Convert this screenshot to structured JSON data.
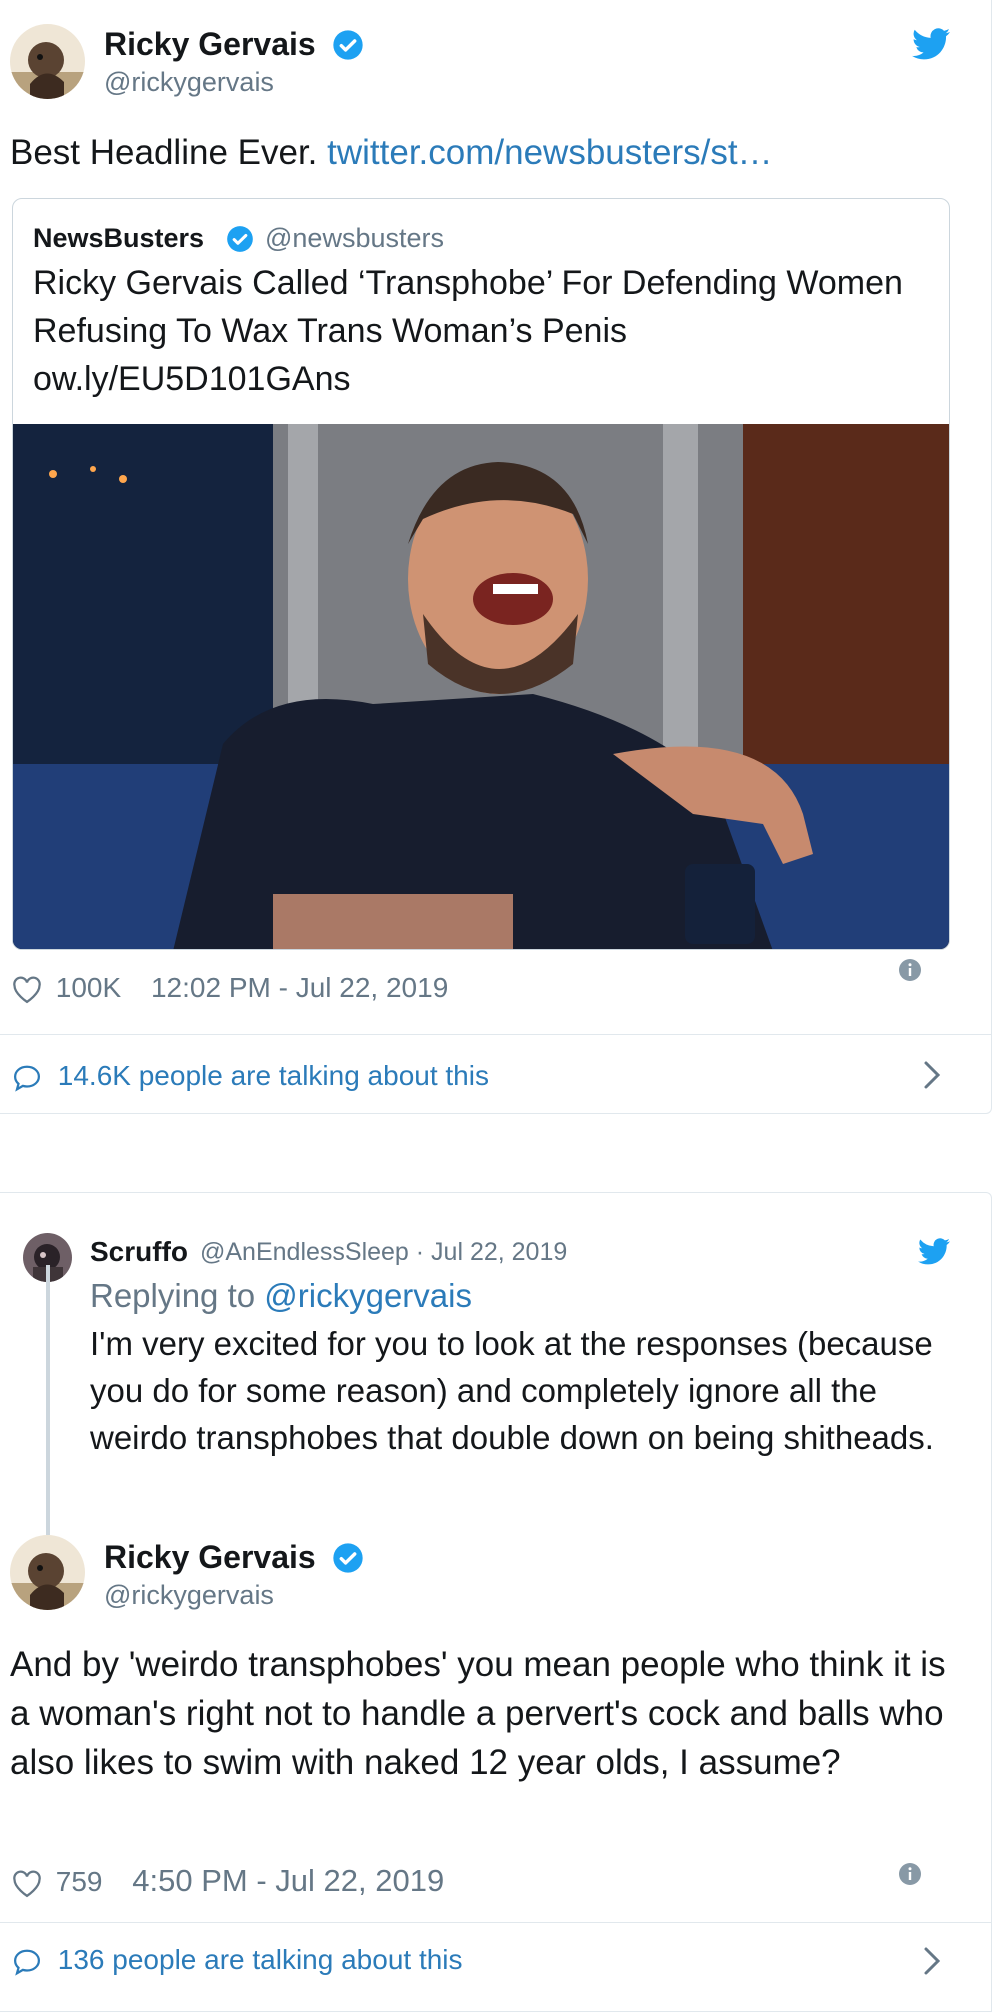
{
  "tweet1": {
    "author_name": "Ricky Gervais",
    "author_handle": "@rickygervais",
    "text": "Best Headline Ever.",
    "link_text": "twitter.com/newsbusters/st…",
    "quote": {
      "author_name": "NewsBusters",
      "author_handle": "@newsbusters",
      "text": "Ricky Gervais Called ‘Transphobe’ For Defending Women Refusing To Wax Trans Woman’s Penis",
      "link": "ow.ly/EU5D101GAns"
    },
    "likes": "100K",
    "timestamp": "12:02 PM - Jul 22, 2019",
    "talking": "14.6K people are talking about this"
  },
  "tweet2": {
    "reply": {
      "author_name": "Scruffo",
      "author_handle": "@AnEndlessSleep · Jul 22, 2019",
      "replying_label": "Replying to",
      "replying_handle": "@rickygervais",
      "text": "I'm very excited for you to look at the responses (because you do for some reason) and completely ignore all the weirdo transphobes that double down on being shitheads."
    },
    "author_name": "Ricky Gervais",
    "author_handle": "@rickygervais",
    "text": "And by 'weirdo transphobes' you mean people who think it is a woman's right not to handle a pervert's cock and balls who also likes to swim with naked 12 year olds, I assume?",
    "likes": "759",
    "timestamp": "4:50 PM - Jul 22, 2019",
    "talking": "136 people are talking about this"
  },
  "colors": {
    "accent": "#1da1f2",
    "link": "#2b7bb9",
    "muted": "#657786",
    "border": "#e1e8ed"
  },
  "icons": [
    "verified-icon",
    "twitter-bird-icon",
    "heart-icon",
    "info-icon",
    "comment-icon",
    "chevron-right-icon"
  ]
}
